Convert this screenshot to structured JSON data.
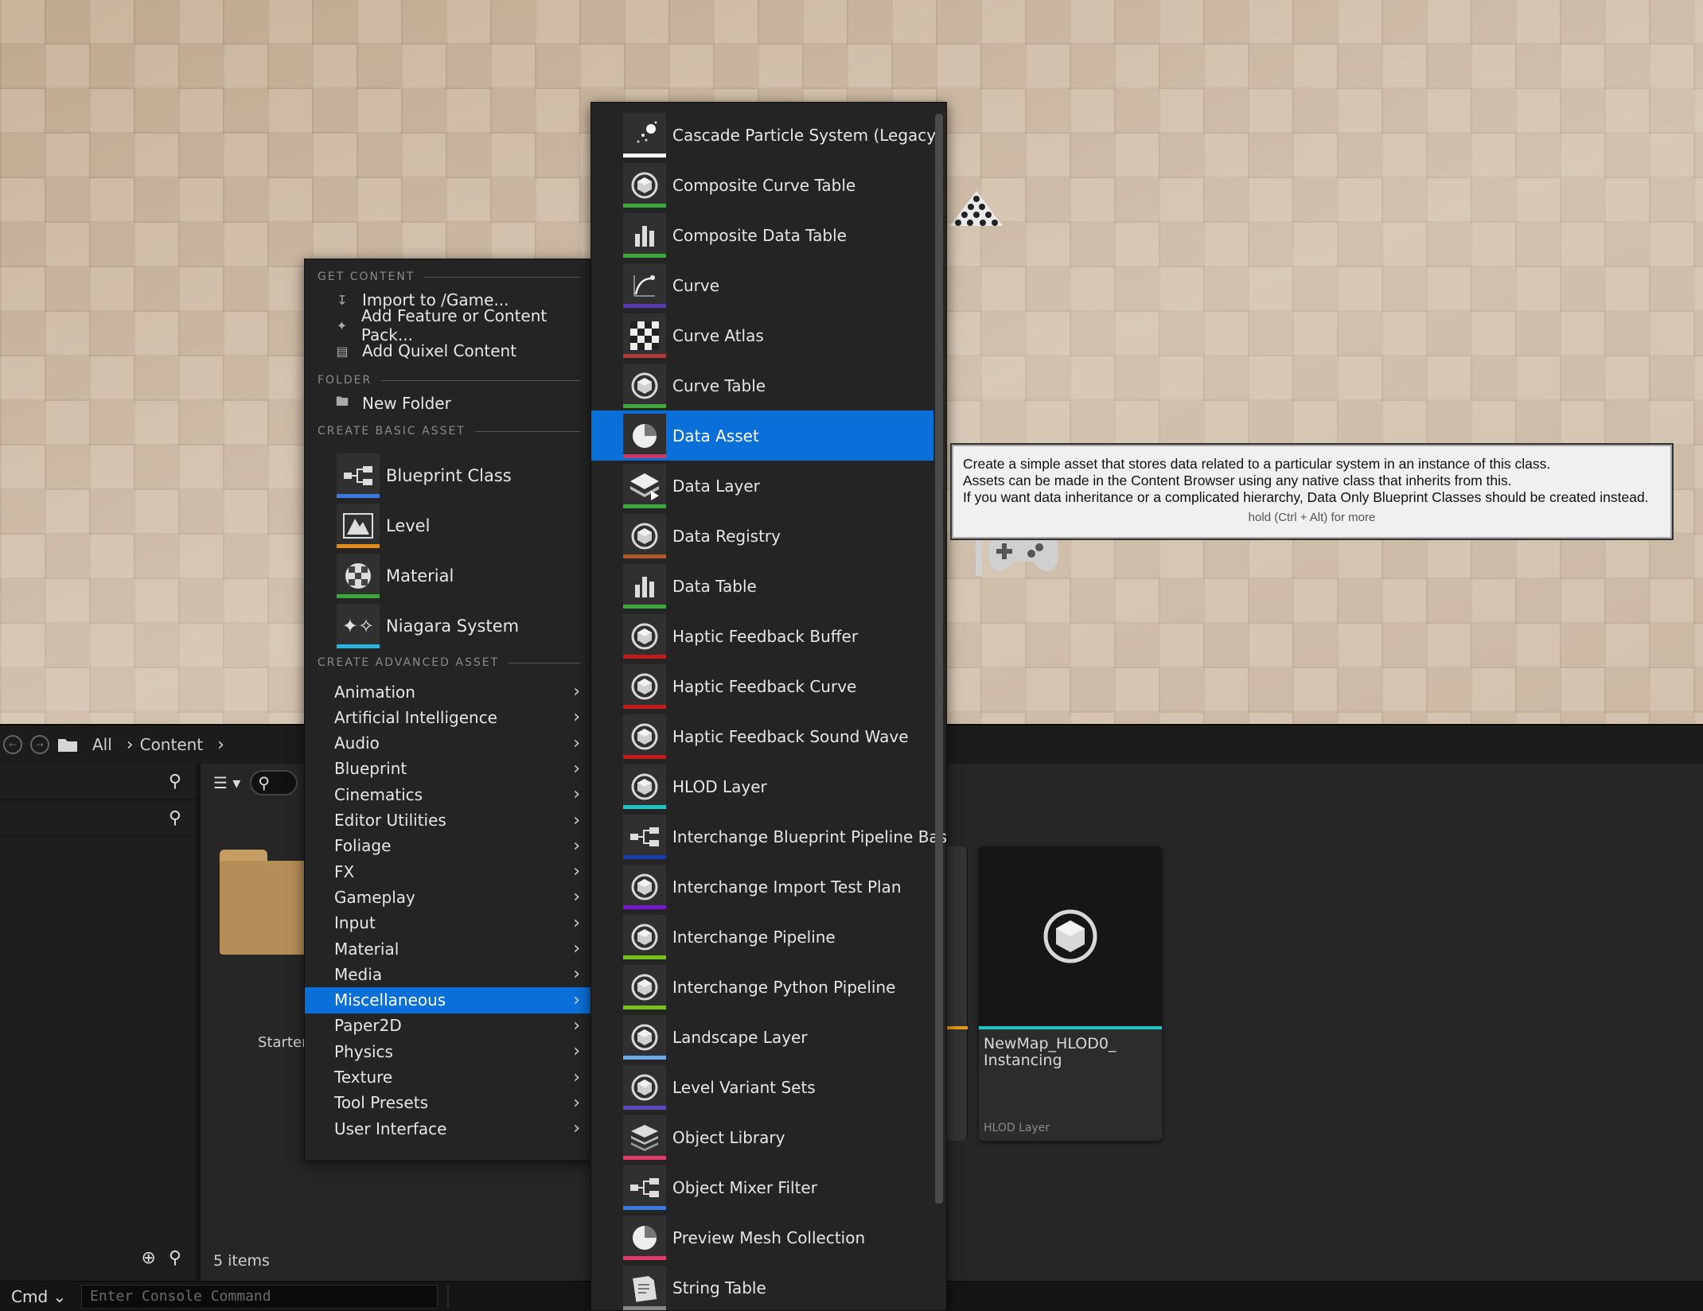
{
  "get_content": {
    "header": "GET CONTENT",
    "items": [
      {
        "label": "Import to /Game...",
        "icon": "import-icon"
      },
      {
        "label": "Add Feature or Content Pack...",
        "icon": "feature-pack-icon"
      },
      {
        "label": "Add Quixel Content",
        "icon": "quixel-icon"
      }
    ]
  },
  "folder": {
    "header": "FOLDER",
    "new_folder_label": "New Folder"
  },
  "basic": {
    "header": "CREATE BASIC ASSET",
    "items": [
      {
        "label": "Blueprint Class",
        "icon": "blueprint-icon",
        "color": "#3a7ae0"
      },
      {
        "label": "Level",
        "icon": "level-icon",
        "color": "#e08a1a"
      },
      {
        "label": "Material",
        "icon": "material-icon",
        "color": "#3aa83a"
      },
      {
        "label": "Niagara System",
        "icon": "niagara-icon",
        "color": "#2ab4e0"
      }
    ]
  },
  "advanced": {
    "header": "CREATE ADVANCED ASSET",
    "items": [
      {
        "label": "Animation"
      },
      {
        "label": "Artificial Intelligence"
      },
      {
        "label": "Audio"
      },
      {
        "label": "Blueprint"
      },
      {
        "label": "Cinematics"
      },
      {
        "label": "Editor Utilities"
      },
      {
        "label": "Foliage"
      },
      {
        "label": "FX"
      },
      {
        "label": "Gameplay"
      },
      {
        "label": "Input"
      },
      {
        "label": "Material"
      },
      {
        "label": "Media"
      },
      {
        "label": "Miscellaneous",
        "active": true
      },
      {
        "label": "Paper2D"
      },
      {
        "label": "Physics"
      },
      {
        "label": "Texture"
      },
      {
        "label": "Tool Presets"
      },
      {
        "label": "User Interface"
      }
    ]
  },
  "misc_submenu": {
    "items": [
      {
        "label": "Cascade Particle System (Legacy)",
        "icon": "particle-icon",
        "color": "#ffffff"
      },
      {
        "label": "Composite Curve Table",
        "icon": "cube-icon",
        "color": "#3aa83a"
      },
      {
        "label": "Composite Data Table",
        "icon": "bar-chart-icon",
        "color": "#3aa83a"
      },
      {
        "label": "Curve",
        "icon": "curve-icon",
        "color": "#5a3ab0"
      },
      {
        "label": "Curve Atlas",
        "icon": "checker-icon",
        "color": "#b03a3a"
      },
      {
        "label": "Curve Table",
        "icon": "cube-icon",
        "color": "#3aa83a"
      },
      {
        "label": "Data Asset",
        "icon": "pie-icon",
        "color": "#c83a6a",
        "active": true
      },
      {
        "label": "Data Layer",
        "icon": "layer-icon",
        "color": "#3aa83a"
      },
      {
        "label": "Data Registry",
        "icon": "cube-icon",
        "color": "#b05a2a"
      },
      {
        "label": "Data Table",
        "icon": "bar-chart-icon",
        "color": "#3aa83a"
      },
      {
        "label": "Haptic Feedback Buffer",
        "icon": "cube-icon",
        "color": "#c01a1a"
      },
      {
        "label": "Haptic Feedback Curve",
        "icon": "cube-icon",
        "color": "#c01a1a"
      },
      {
        "label": "Haptic Feedback Sound Wave",
        "icon": "cube-icon",
        "color": "#c01a1a"
      },
      {
        "label": "HLOD Layer",
        "icon": "cube-icon",
        "color": "#1ec4c4"
      },
      {
        "label": "Interchange Blueprint Pipeline Base",
        "icon": "blueprint-icon",
        "color": "#1a3ab0"
      },
      {
        "label": "Interchange Import Test Plan",
        "icon": "cube-icon",
        "color": "#7a1ad0"
      },
      {
        "label": "Interchange Pipeline",
        "icon": "cube-icon",
        "color": "#7ac01a"
      },
      {
        "label": "Interchange Python Pipeline",
        "icon": "cube-icon",
        "color": "#7ac01a"
      },
      {
        "label": "Landscape Layer",
        "icon": "cube-icon",
        "color": "#6aa8e8"
      },
      {
        "label": "Level Variant Sets",
        "icon": "cube-icon",
        "color": "#5a4ac0"
      },
      {
        "label": "Object Library",
        "icon": "stack-icon",
        "color": "#e03a6a"
      },
      {
        "label": "Object Mixer Filter",
        "icon": "blueprint-icon",
        "color": "#3a7ae0"
      },
      {
        "label": "Preview Mesh Collection",
        "icon": "pie-icon",
        "color": "#e03a6a"
      },
      {
        "label": "String Table",
        "icon": "document-icon",
        "color": "#888888"
      }
    ]
  },
  "tooltip": {
    "line1": "Create a simple asset that stores data related to a particular system in an instance of this class.",
    "line2": "Assets can be made in the Content Browser using any native class that inherits from this.",
    "line3": "If you want data inheritance or a complicated hierarchy, Data Only Blueprint Classes should be created instead.",
    "hint": "hold (Ctrl + Alt) for more"
  },
  "content_browser": {
    "breadcrumb": [
      "All",
      "Content"
    ],
    "folder_label": "Starter",
    "asset_name": "NewMap_HLOD0_ Instancing",
    "asset_type": "HLOD Layer",
    "items_count": "5 items"
  },
  "console": {
    "cmd_label": "Cmd",
    "placeholder": "Enter Console Command"
  }
}
